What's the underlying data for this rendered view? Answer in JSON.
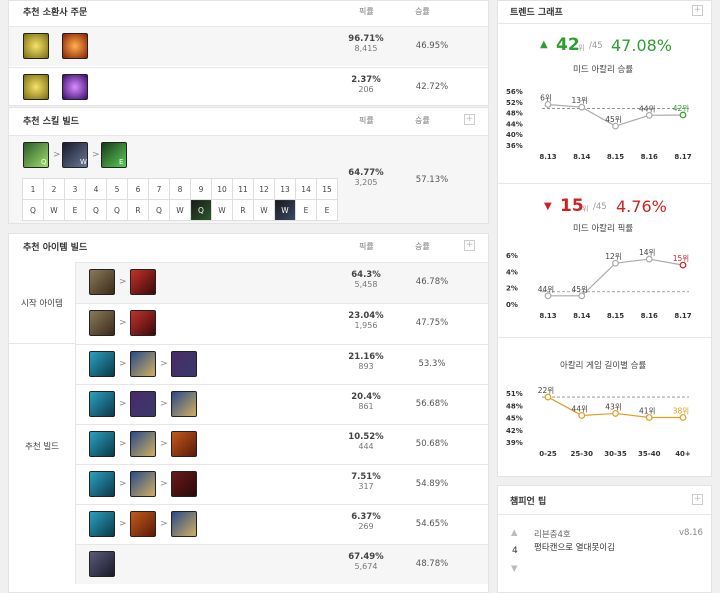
{
  "spells": {
    "title": "추천 소환사 주문",
    "pick_hd": "픽률",
    "win_hd": "승률",
    "rows": [
      {
        "pick": "96.71%",
        "count": "8,415",
        "win": "46.95%"
      },
      {
        "pick": "2.37%",
        "count": "206",
        "win": "42.72%"
      }
    ]
  },
  "skills": {
    "title": "추천 스킬 빌드",
    "pick_hd": "픽률",
    "win_hd": "승률",
    "plus": "+",
    "order": [
      "Q",
      "W",
      "E"
    ],
    "pick": "64.77%",
    "count": "3,205",
    "win": "57.13%",
    "levels": [
      "1",
      "2",
      "3",
      "4",
      "5",
      "6",
      "7",
      "8",
      "9",
      "10",
      "11",
      "12",
      "13",
      "14",
      "15"
    ],
    "keys": [
      "Q",
      "W",
      "E",
      "Q",
      "Q",
      "R",
      "Q",
      "W",
      "Q",
      "W",
      "R",
      "W",
      "W",
      "E",
      "E"
    ]
  },
  "items": {
    "title": "추천 아이템 빌드",
    "pick_hd": "픽률",
    "win_hd": "승률",
    "plus": "+",
    "start_label": "시작 아이템",
    "build_label": "추천 빌드",
    "start": [
      {
        "pick": "64.3%",
        "count": "5,458",
        "win": "46.78%"
      },
      {
        "pick": "23.04%",
        "count": "1,956",
        "win": "47.75%"
      }
    ],
    "builds": [
      {
        "pick": "21.16%",
        "count": "893",
        "win": "53.3%"
      },
      {
        "pick": "20.4%",
        "count": "861",
        "win": "56.68%"
      },
      {
        "pick": "10.52%",
        "count": "444",
        "win": "50.68%"
      },
      {
        "pick": "7.51%",
        "count": "317",
        "win": "54.89%"
      },
      {
        "pick": "6.37%",
        "count": "269",
        "win": "54.65%"
      }
    ],
    "boots": {
      "pick": "67.49%",
      "count": "5,674",
      "win": "48.78%"
    }
  },
  "trend": {
    "title": "트렌드 그래프",
    "plus": "+",
    "win": {
      "rank": "42",
      "rank_suffix": "위",
      "total": "/45",
      "value": "47.08%",
      "caption": "미드 아칼리 승률",
      "chart_data": {
        "type": "line",
        "categories": [
          "8.13",
          "8.14",
          "8.15",
          "8.16",
          "8.17"
        ],
        "ylabels": [
          "56%",
          "52%",
          "48%",
          "44%",
          "40%",
          "36%"
        ],
        "ylim": [
          36,
          56
        ],
        "values": [
          51,
          50,
          43,
          47,
          47.1
        ],
        "ranks": [
          "6위",
          "13위",
          "45위",
          "44위",
          "42위"
        ],
        "ref": 49.5
      }
    },
    "pick": {
      "rank": "15",
      "rank_suffix": "위",
      "total": "/45",
      "value": "4.76%",
      "caption": "미드 아칼리 픽률",
      "chart_data": {
        "type": "line",
        "categories": [
          "8.13",
          "8.14",
          "8.15",
          "8.16",
          "8.17"
        ],
        "ylabels": [
          "6%",
          "4%",
          "2%",
          "0%"
        ],
        "ylim": [
          0,
          6
        ],
        "values": [
          1.0,
          1.0,
          5.0,
          5.5,
          4.76
        ],
        "ranks": [
          "44위",
          "45위",
          "12위",
          "14위",
          "15위"
        ],
        "ref": 1.5
      }
    },
    "tier": {
      "caption": "아칼리 게임 길이별 승률",
      "chart_data": {
        "type": "line",
        "categories": [
          "0-25",
          "25-30",
          "30-35",
          "35-40",
          "40+"
        ],
        "ylabels": [
          "51%",
          "48%",
          "45%",
          "42%",
          "39%"
        ],
        "ylim": [
          39,
          51
        ],
        "values": [
          50,
          45.5,
          46,
          45,
          45
        ],
        "ranks": [
          "22위",
          "44위",
          "43위",
          "41위",
          "38위"
        ],
        "ref": 50
      }
    }
  },
  "tips": {
    "title": "챔피언 팁",
    "plus": "+",
    "vote": "4",
    "text1": "리븐충4호",
    "text2": "평타캔으로 열대못이김",
    "version": "v8.16",
    "up": "▲",
    "down": "▼"
  }
}
